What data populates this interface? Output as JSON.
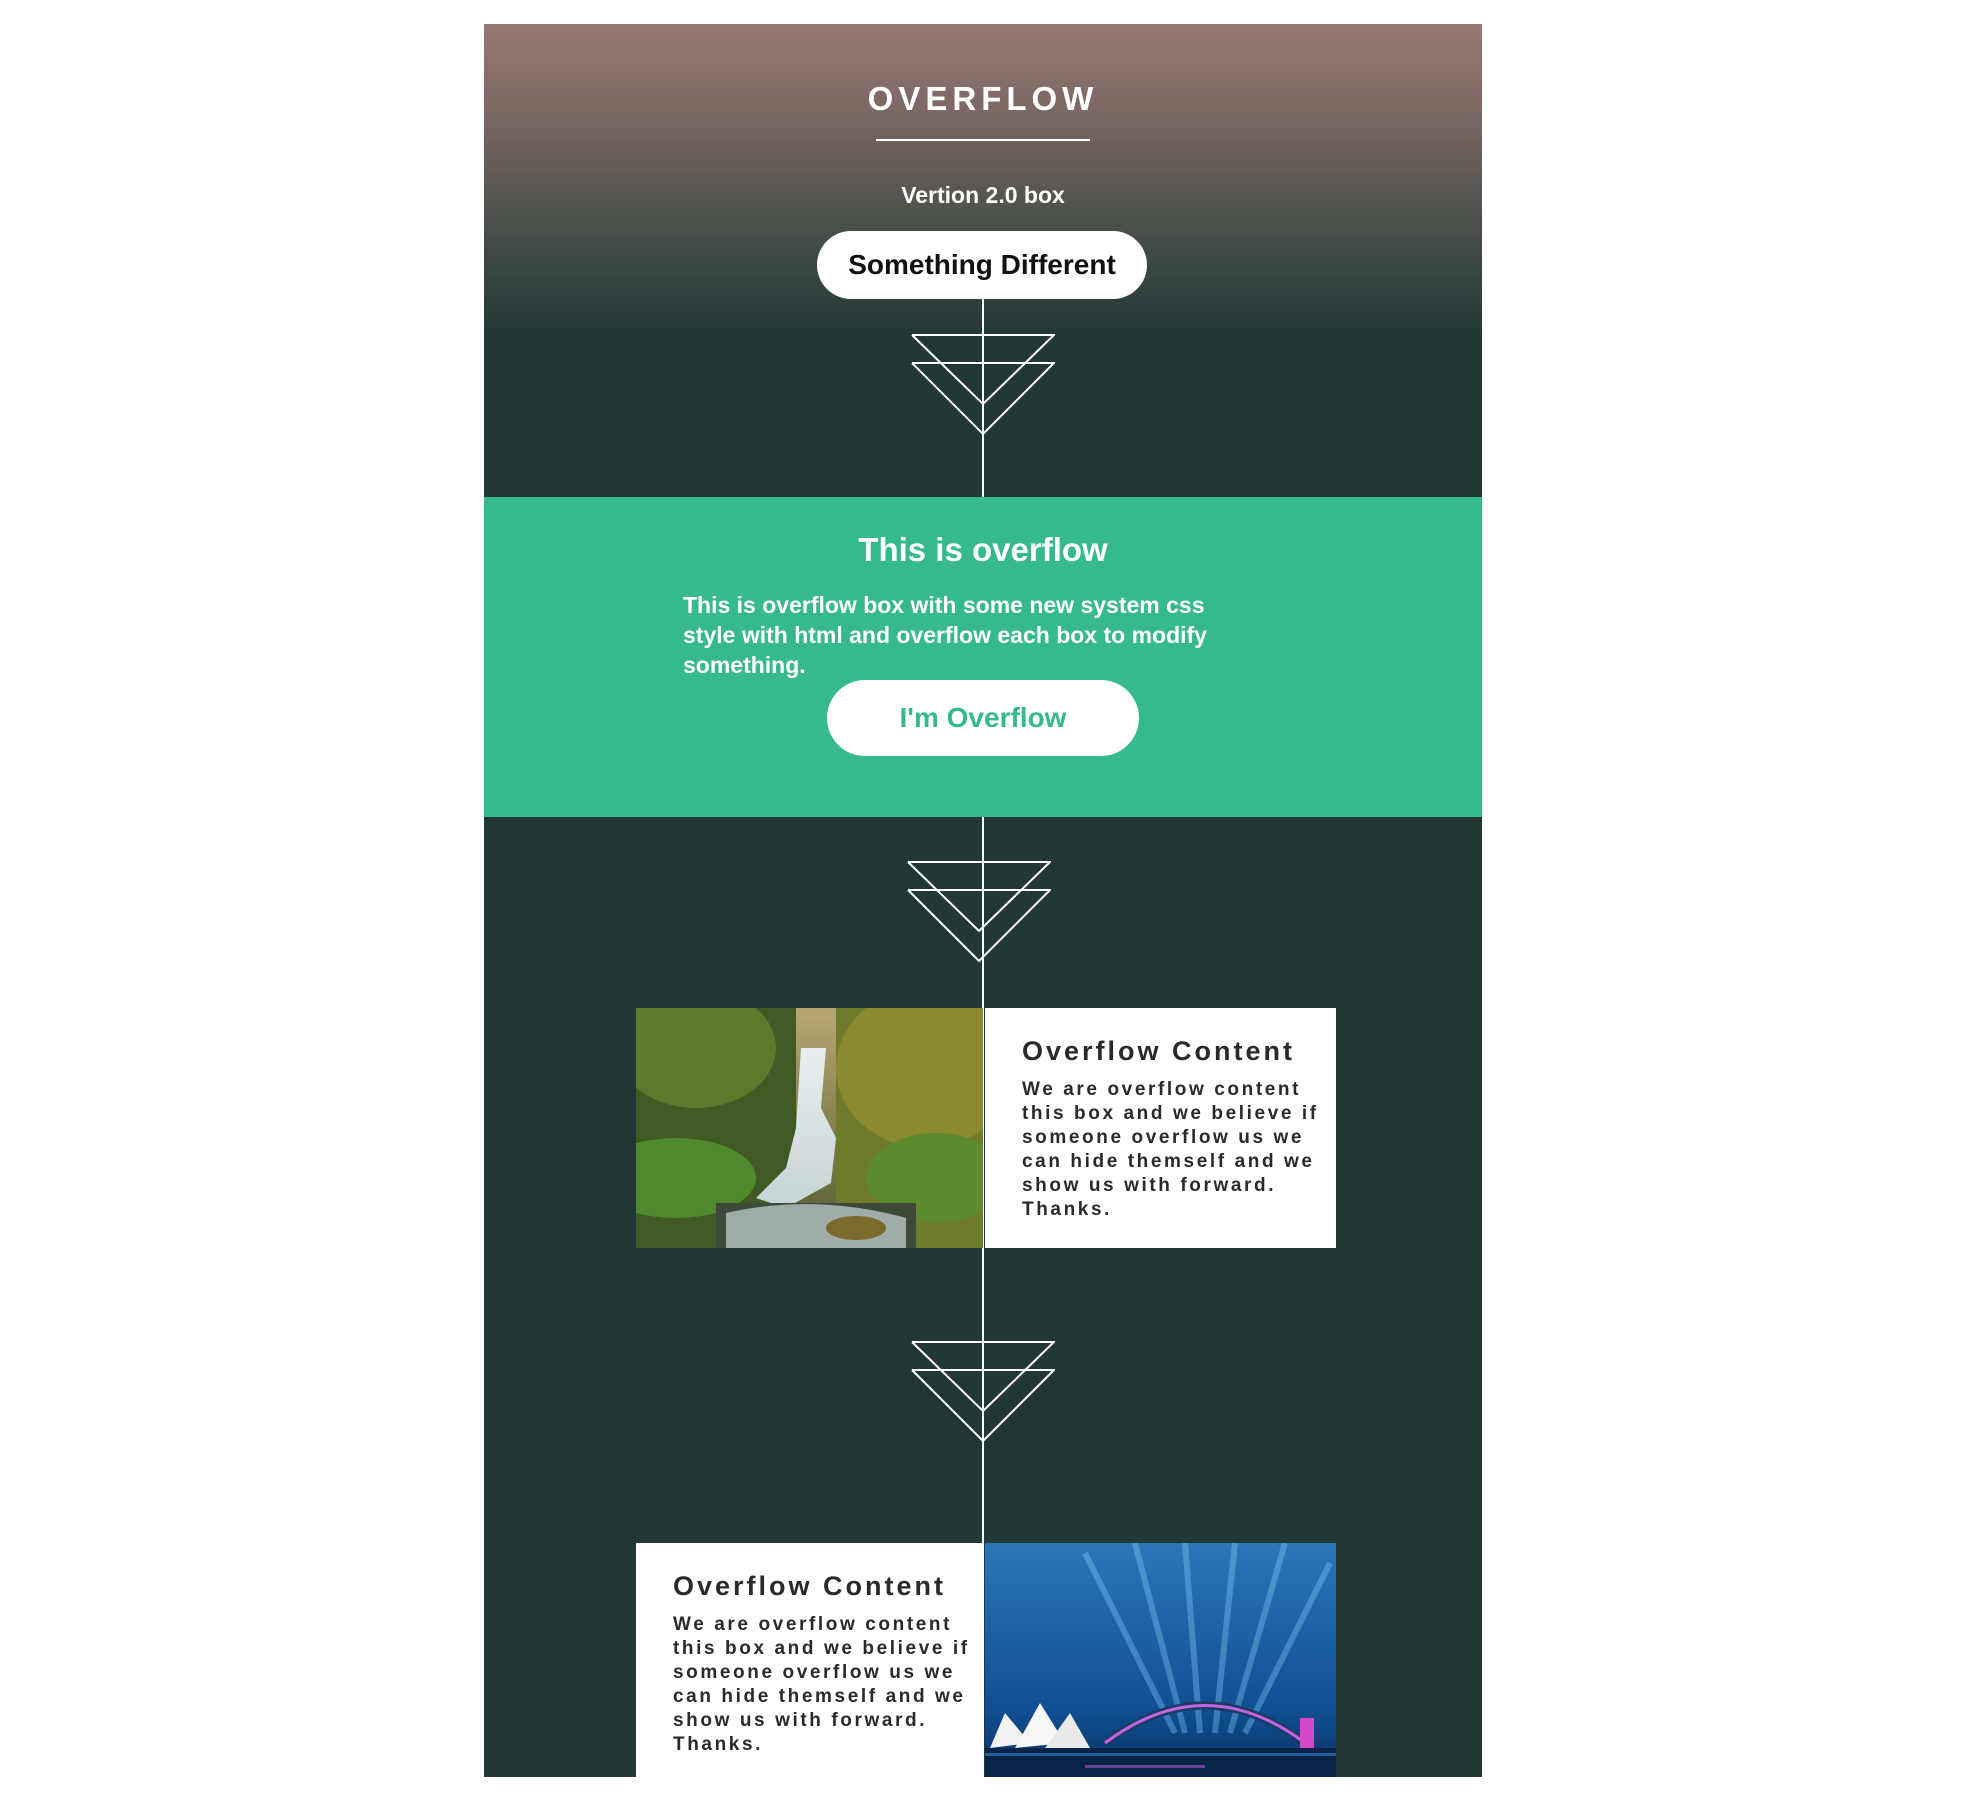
{
  "hero": {
    "title": "OVERFLOW",
    "version": "Vertion 2.0 box",
    "button_label": "Something Different"
  },
  "overflow_section": {
    "title": "This is overflow",
    "text": "This is overflow box with some new system css style with html and overflow each box to modify something.",
    "button_label": "I'm Overflow"
  },
  "cards": [
    {
      "title": "Overflow Content",
      "body": "We are overflow content this box and we believe if someone overflow us we can hide themself and we show us with forward. Thanks.",
      "image": "waterfall-photo"
    },
    {
      "title": "Overflow Content",
      "body": "We are overflow content this box and we believe if someone overflow us we can hide themself and we show us with forward. Thanks.",
      "image": "sydney-opera-house-night-photo"
    }
  ],
  "icons": [
    "double-triangle-icon"
  ],
  "colors": {
    "background_dark": "#213836",
    "accent_green": "#37b98e",
    "hero_top": "#977876",
    "white": "#ffffff",
    "text_dark": "#2a2a2a"
  }
}
